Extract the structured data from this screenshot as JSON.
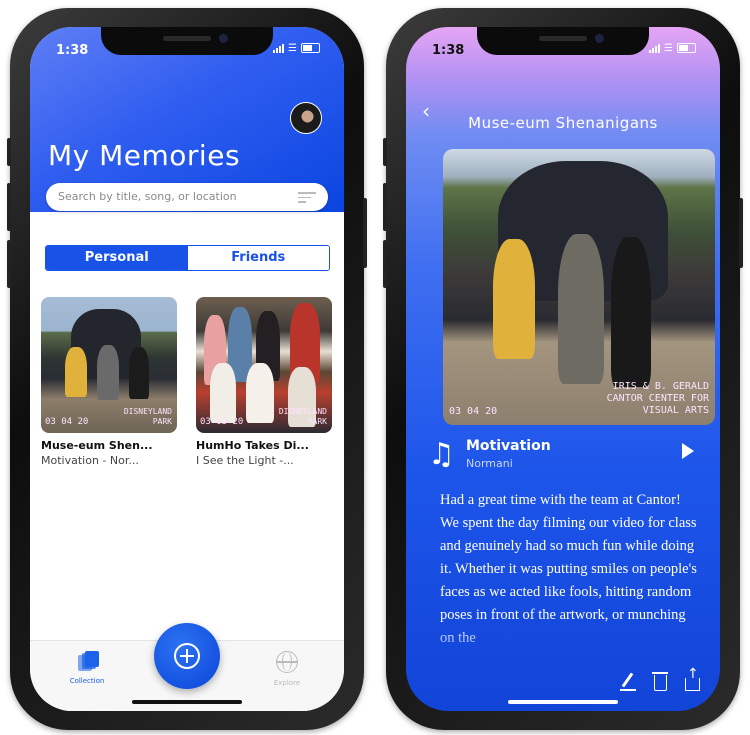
{
  "status": {
    "time": "1:38"
  },
  "left": {
    "title": "My Memories",
    "search_placeholder": "Search by title, song, or location",
    "tabs": [
      {
        "label": "Personal",
        "active": true
      },
      {
        "label": "Friends",
        "active": false
      }
    ],
    "cards": [
      {
        "date": "03 04 20",
        "location": "DISNEYLAND\nPARK",
        "title": "Muse-eum Shen...",
        "subtitle": "Motivation - Nor..."
      },
      {
        "date": "03 03 20",
        "location": "DISNEYLAND\nPARK",
        "title": "HumHo Takes Di...",
        "subtitle": "I See the Light -..."
      }
    ],
    "tabbar": {
      "collection_label": "Collection",
      "explore_label": "Explore"
    },
    "colors": {
      "accent": "#1852e6"
    }
  },
  "right": {
    "title": "Muse-eum Shenanigans",
    "photo": {
      "date": "03 04 20",
      "location": "IRIS & B. GERALD\nCANTOR CENTER FOR\nVISUAL ARTS"
    },
    "song": {
      "title": "Motivation",
      "artist": "Normani"
    },
    "description": "Had a great time with the team at Cantor! We spent the day filming our video for class and genuinely had so much fun while doing it. Whether it was putting smiles on people's faces as we acted like fools, hitting random poses in front of the artwork, or munching on the"
  }
}
